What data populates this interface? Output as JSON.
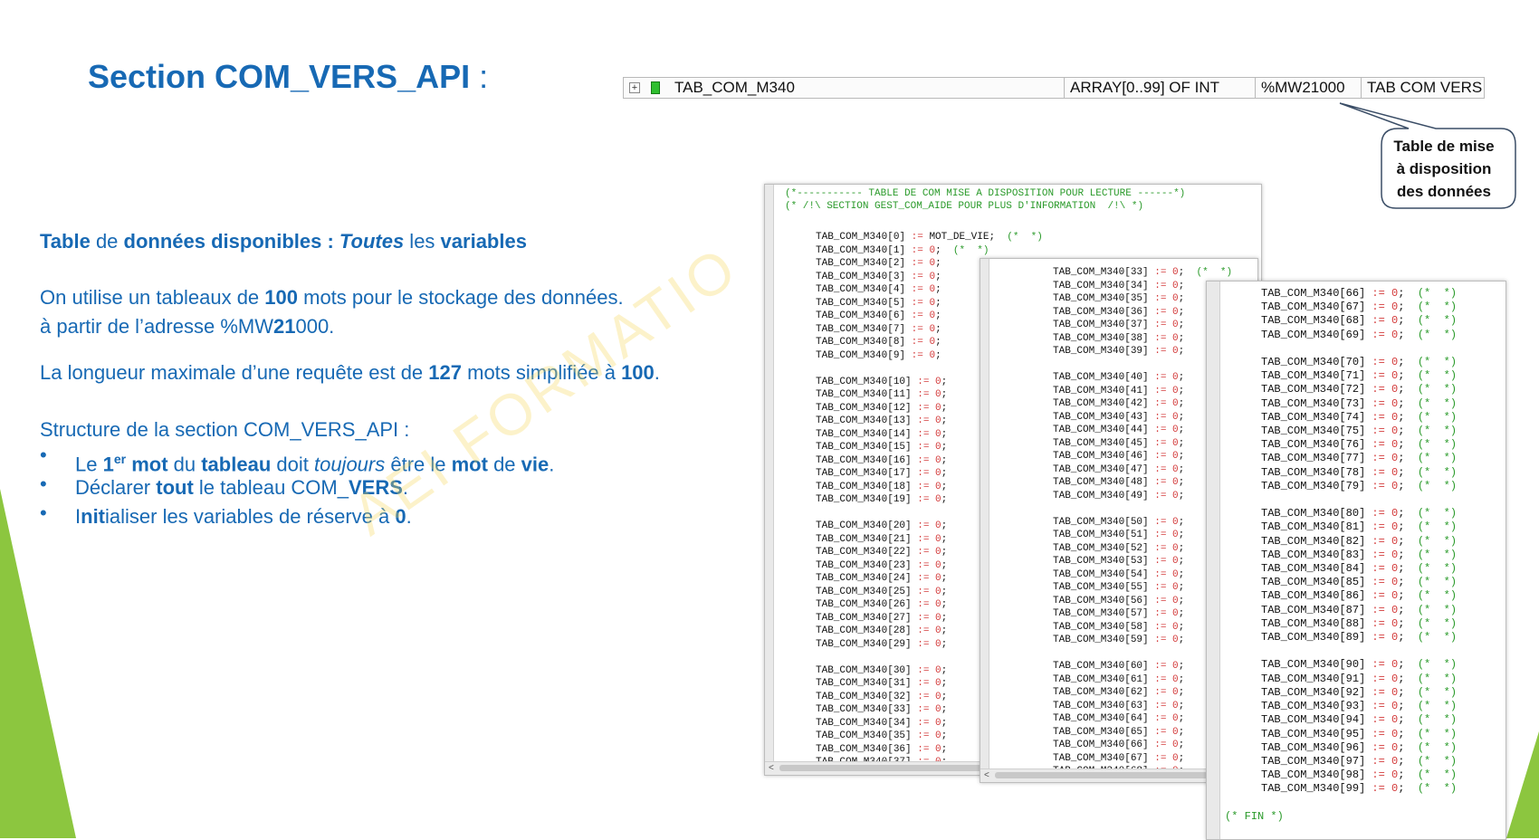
{
  "slide": {
    "title": "Section  COM_VERS_API",
    "title_colon": " :",
    "colors": {
      "accent": "#1769b4",
      "green": "#8cc63f",
      "code_comment": "#2a9a2a",
      "code_number": "#d33a3a"
    }
  },
  "variable_row": {
    "expand_icon": "plus-box-icon",
    "name": "TAB_COM_M340",
    "type": "ARRAY[0..99] OF INT",
    "address": "%MW21000",
    "comment": "TAB COM VERS"
  },
  "callout": {
    "line1": "Table de mise",
    "line2": "à disposition",
    "line3": "des données"
  },
  "text": {
    "p1": {
      "a": "Table",
      "b": " de ",
      "c": "données disponibles : ",
      "d": "Toutes",
      "e": " les ",
      "f": "variables"
    },
    "p2": {
      "a": "On utilise un tableaux de ",
      "b": "100",
      "c": " mots pour le stockage des données."
    },
    "p3": {
      "a": "à partir de l’adresse %MW",
      "b": "21",
      "c": "000."
    },
    "p4": {
      "a": "La longueur maximale d’une requête est de ",
      "b": "127",
      "c": " mots simplifiée à ",
      "d": "100",
      "e": "."
    },
    "p5": "Structure de la section  COM_VERS_API :",
    "bullet_symbol": "•",
    "b1": {
      "a": "Le ",
      "b": "1",
      "sup": "er",
      "c": " mot",
      "d": " du ",
      "e": "tableau",
      "f": " doit ",
      "g": "toujours",
      "h": " être le ",
      "i": "mot",
      "j": " de ",
      "k": "vie",
      "l": "."
    },
    "b2": {
      "a": "Déclarer ",
      "b": "tout",
      "c": " le tableau COM_",
      "d": "VERS",
      "e": "."
    },
    "b3": {
      "a": "I",
      "b": "nit",
      "c": "ialiser les variables de réserve à ",
      "d": "0",
      "e": "."
    }
  },
  "watermark": "AEI    FORMATIO",
  "code": {
    "header1": "(*----------- TABLE DE COM MISE A DISPOSITION POUR LECTURE ------*)",
    "header2": "(* /!\\ SECTION GEST_COM_AIDE POUR PLUS D'INFORMATION  /!\\ *)",
    "array_name": "TAB_COM_M340",
    "first_value": "MOT_DE_VIE",
    "zero": "0",
    "comment": "(*  *)",
    "end": "(* FIN *)",
    "scroll_left_icon": "chevron-left-icon"
  }
}
